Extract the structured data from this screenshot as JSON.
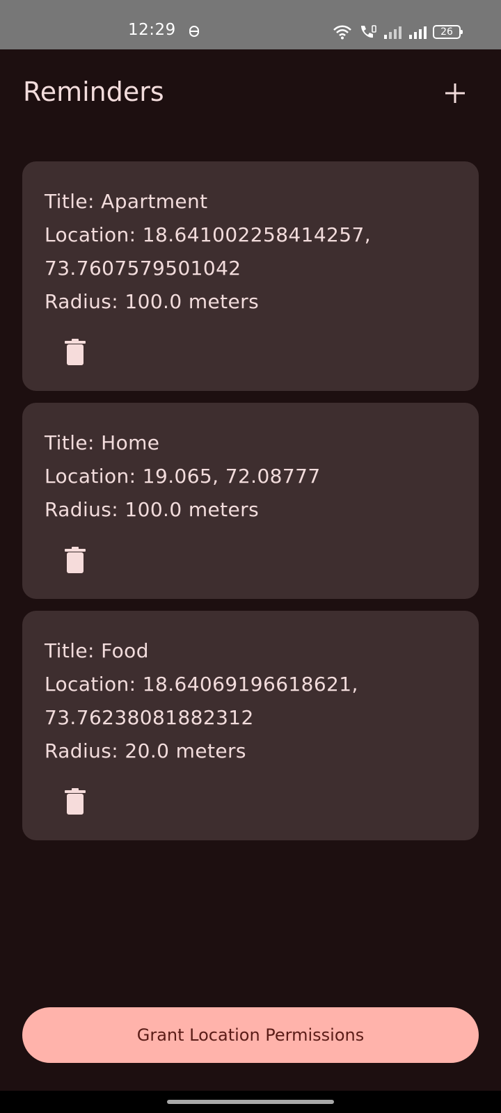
{
  "status_bar": {
    "time": "12:29",
    "battery": "26",
    "icons": [
      "nfc-icon",
      "wifi-icon",
      "call-icon",
      "signal-icon-1",
      "signal-icon-2",
      "battery-icon"
    ]
  },
  "app_bar": {
    "title": "Reminders",
    "add_icon": "plus-icon"
  },
  "reminders": [
    {
      "title": "Title: Apartment",
      "location_line1": "Location: 18.641002258414257,",
      "location_line2": "73.7607579501042",
      "radius": "Radius: 100.0 meters",
      "delete_icon": "trash-icon"
    },
    {
      "title": "Title: Home",
      "location_line1": "Location: 19.065, 72.08777",
      "location_line2": "",
      "radius": "Radius: 100.0 meters",
      "delete_icon": "trash-icon"
    },
    {
      "title": "Title: Food",
      "location_line1": "Location: 18.64069196618621,",
      "location_line2": "73.76238081882312",
      "radius": "Radius: 20.0 meters",
      "delete_icon": "trash-icon"
    }
  ],
  "grant_button": {
    "label": "Grant Location Permissions"
  },
  "colors": {
    "background": "#1d0f10",
    "card": "#3e2e2f",
    "text": "#f2dcdc",
    "primary": "#ffb3ab",
    "on_primary": "#5a1c17"
  }
}
